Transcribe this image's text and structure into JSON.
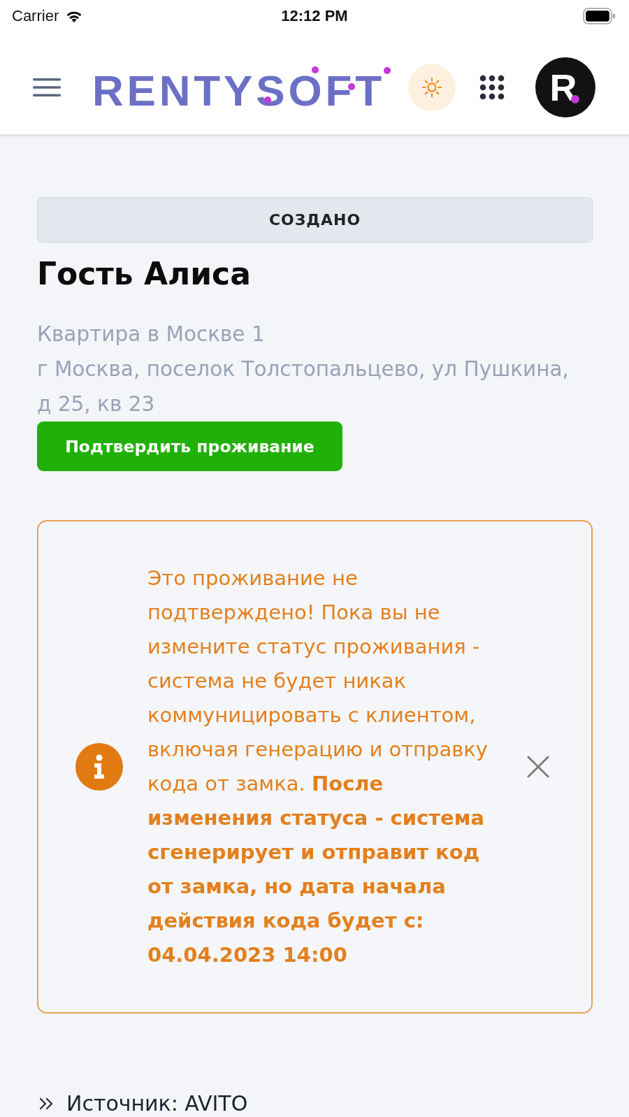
{
  "status_bar": {
    "carrier": "Carrier",
    "time": "12:12 PM"
  },
  "header": {
    "logo": "RENTYSOFT",
    "avatar": "R"
  },
  "booking": {
    "status": "СОЗДАНО",
    "guest": "Гость Алиса",
    "property": "Квартира в Москве 1",
    "address": "г Москва, поселок Толстопальцево, ул Пушкина, д 25, кв 23",
    "confirm_button": "Подтвердить проживание"
  },
  "alert": {
    "message": "Это проживание не подтверждено! Пока вы не измените статус проживания - система не будет никак коммуницировать с клиентом, включая генерацию и отправку кода от замка. **После изменения статуса - система сгенерирует и отправит код от замка, но дата начала действия кода будет с: 04.04.2023 14:00**",
    "dismissible": true
  },
  "source": "Источник: AVITO"
}
